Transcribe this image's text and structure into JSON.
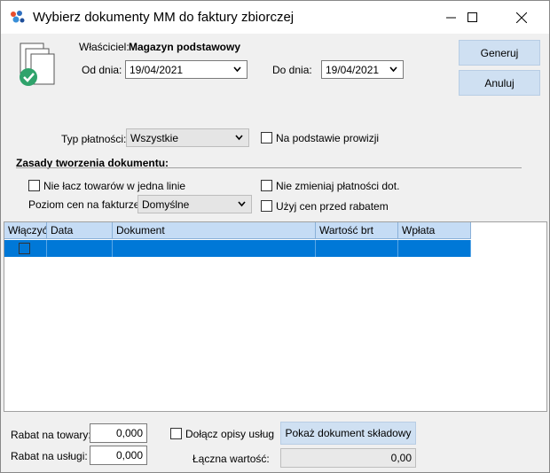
{
  "window": {
    "title": "Wybierz dokumenty MM do faktury zbiorczej"
  },
  "header": {
    "owner_label": "Właściciel:",
    "owner_value": "Magazyn podstawowy",
    "date_from_label": "Od dnia:",
    "date_from_value": "19/04/2021",
    "date_to_label": "Do dnia:",
    "date_to_value": "19/04/2021"
  },
  "buttons": {
    "generate": "Generuj",
    "cancel": "Anuluj",
    "show_document": "Pokaż dokument składowy"
  },
  "payment": {
    "type_label": "Typ płatności:",
    "type_value": "Wszystkie",
    "commission_label": "Na podstawie prowizji"
  },
  "rules": {
    "heading": "Zasady tworzenia dokumentu:",
    "no_merge_label": "Nie łacz towarów w jedna linie",
    "no_change_payment_label": "Nie zmieniaj płatności dot.",
    "price_level_label": "Poziom cen na fakturze",
    "price_level_value": "Domyślne",
    "use_prices_label": "Użyj cen przed rabatem"
  },
  "table": {
    "columns": [
      "Włączyć",
      "Data",
      "Dokument",
      "Wartość brt",
      "Wpłata"
    ]
  },
  "footer": {
    "discount_goods_label": "Rabat na towary:",
    "discount_goods_value": "0,000",
    "discount_services_label": "Rabat na usługi:",
    "discount_services_value": "0,000",
    "attach_desc_label": "Dołącz opisy usług",
    "total_label": "Łączna wartość:",
    "total_value": "0,00"
  },
  "colors": {
    "button_bg": "#cfe0f2",
    "grid_header": "#c5dcf5",
    "selection": "#0078d7"
  }
}
